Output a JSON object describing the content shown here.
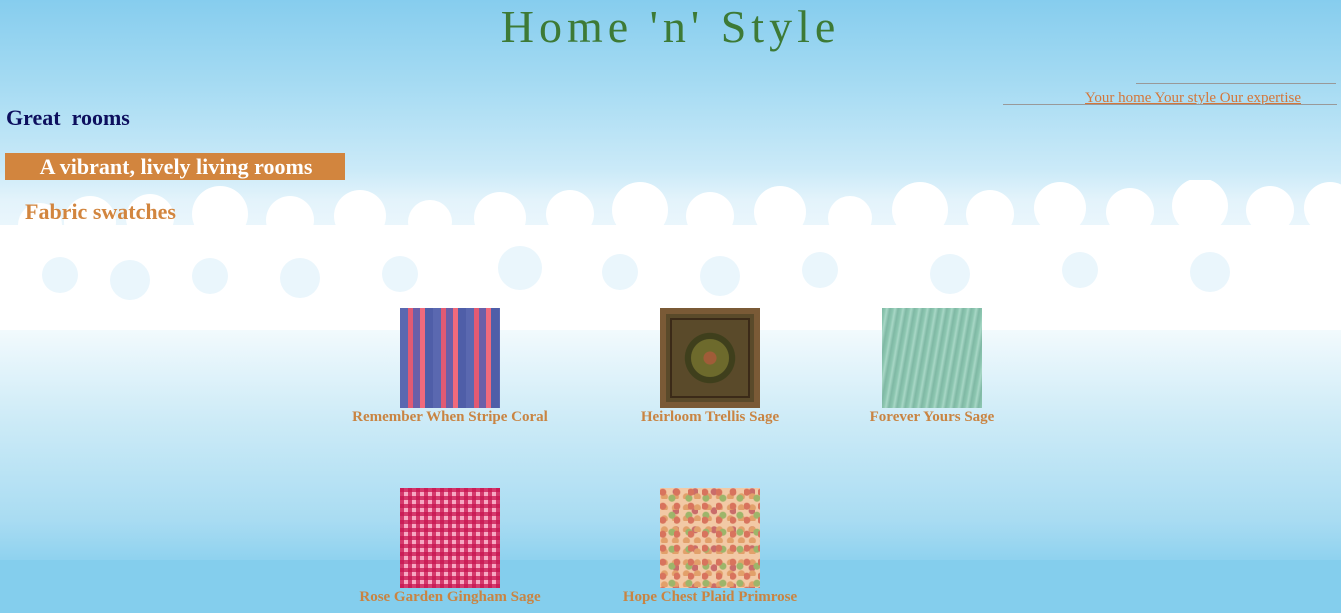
{
  "header": {
    "site_title": "Home 'n' Style"
  },
  "tagline": {
    "text": "Your home Your style Our expertise"
  },
  "content": {
    "section_heading": "Great  rooms",
    "banner": "A vibrant, lively living rooms",
    "sub_heading": "Fabric swatches",
    "swatches": [
      {
        "name": "Remember When Stripe Coral",
        "icon": "stripe-fabric"
      },
      {
        "name": "Heirloom Trellis Sage",
        "icon": "rug-fabric"
      },
      {
        "name": "Forever Yours Sage",
        "icon": "woodgrain-fabric"
      },
      {
        "name": "Rose Garden Gingham Sage",
        "icon": "gingham-fabric"
      },
      {
        "name": "Hope Chest Plaid Primrose",
        "icon": "floral-fabric"
      }
    ]
  },
  "colors": {
    "title": "#3d7a36",
    "heading": "#0d0f5e",
    "accent": "#d2853e",
    "link": "#d4763a",
    "caption": "#c98442"
  }
}
